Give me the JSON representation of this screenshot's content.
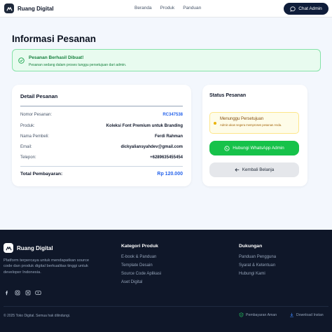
{
  "header": {
    "brand": "Ruang Digital",
    "nav": [
      "Beranda",
      "Produk",
      "Panduan"
    ],
    "chat_button": "Chat Admin"
  },
  "page": {
    "title": "Informasi Pesanan"
  },
  "alert": {
    "title": "Pesanan Berhasil Dibuat!",
    "message": "Pesanan sedang dalam proses tunggu persetujuan dari admin."
  },
  "detail": {
    "title": "Detail Pesanan",
    "rows": [
      {
        "label": "Nomor Pesanan:",
        "value": "RC347538"
      },
      {
        "label": "Produk:",
        "value": "Koleksi Font Premium untuk Branding"
      },
      {
        "label": "Nama Pembeli:",
        "value": "Ferdi Rahman"
      },
      {
        "label": "Email:",
        "value": "dickyaliansyahdev@gmail.com"
      },
      {
        "label": "Telepon:",
        "value": "+6289635455454"
      }
    ],
    "total_label": "Total Pembayaran:",
    "total_value": "Rp 120.000"
  },
  "status": {
    "title": "Status Pesanan",
    "state": "Menunggu Persetujuan",
    "state_note": "Admin akan segera memproses pesanan Anda.",
    "whatsapp_button": "Hubungi WhatsApp Admin",
    "back_button": "Kembali Belanja"
  },
  "footer": {
    "brand": "Ruang Digital",
    "description": "Platform terpercaya untuk mendapatkan source code dan produk digital berkualitas tinggi untuk developer Indonesia.",
    "categories_title": "Kategori Produk",
    "categories": [
      "E-book & Panduan",
      "Template Desain",
      "Source Code Aplikasi",
      "Aset Digital"
    ],
    "support_title": "Dukungan",
    "support": [
      "Panduan Pengguna",
      "Syarat & Ketentuan",
      "Hubungi Kami"
    ],
    "socials": [
      "facebook-icon",
      "instagram-icon",
      "twitter-icon",
      "youtube-icon"
    ],
    "copyright": "© 2025 Toko Digital. Semua hak dilindungi.",
    "secure_payment": "Pembayaran Aman",
    "instant_download": "Download Instan"
  },
  "colors": {
    "primary_dark": "#0f1d3a",
    "accent_blue": "#2563eb",
    "success_green": "#16c24a",
    "footer_bg": "#0f1729"
  }
}
